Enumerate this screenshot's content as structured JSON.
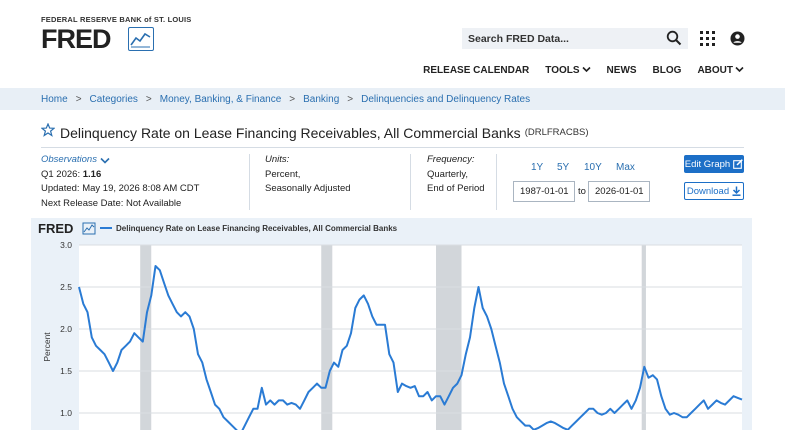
{
  "header": {
    "org": "FEDERAL RESERVE BANK of ST. LOUIS",
    "logo": "FRED",
    "search_placeholder": "Search FRED Data...",
    "icons": [
      "search-icon",
      "apps-grid-icon",
      "account-icon"
    ]
  },
  "nav": {
    "items": [
      {
        "label": "RELEASE CALENDAR"
      },
      {
        "label": "TOOLS"
      },
      {
        "label": "NEWS"
      },
      {
        "label": "BLOG"
      },
      {
        "label": "ABOUT"
      }
    ]
  },
  "breadcrumb": [
    "Home",
    "Categories",
    "Money, Banking, & Finance",
    "Banking",
    "Delinquencies and Delinquency Rates"
  ],
  "series": {
    "title": "Delinquency Rate on Lease Financing Receivables, All Commercial Banks",
    "id": "(DRLFRACBS)"
  },
  "observations": {
    "label": "Observations",
    "latest_period": "Q1 2026:",
    "latest_value": "1.16",
    "updated": "Updated: May 19, 2026 8:08 AM CDT",
    "next_release": "Next Release Date: Not Available"
  },
  "units": {
    "label": "Units:",
    "line1": "Percent,",
    "line2": "Seasonally Adjusted"
  },
  "frequency": {
    "label": "Frequency:",
    "line1": "Quarterly,",
    "line2": "End of Period"
  },
  "range": {
    "buttons": [
      "1Y",
      "5Y",
      "10Y",
      "Max"
    ],
    "start": "1987-01-01",
    "to": "to",
    "end": "2026-01-01"
  },
  "actions": {
    "edit": "Edit Graph",
    "download": "Download"
  },
  "colors": {
    "accent": "#1c6fc7",
    "line": "#2a7bd4",
    "recession": "#d2d6da",
    "panel": "#eaf1f8"
  },
  "chart_data": {
    "type": "line",
    "title": "Delinquency Rate on Lease Financing Receivables, All Commercial Banks",
    "ylabel": "Percent",
    "ylim": [
      0.5,
      3.0
    ],
    "yticks": [
      "3.0",
      "2.5",
      "2.0",
      "1.5",
      "1.0"
    ],
    "x_start": 1987.0,
    "x_end": 2026.0,
    "recessions": [
      [
        1990.6,
        1991.25
      ],
      [
        2001.25,
        2001.9
      ],
      [
        2008.0,
        2009.5
      ],
      [
        2020.1,
        2020.35
      ]
    ],
    "series": [
      {
        "name": "Delinquency Rate on Lease Financing Receivables, All Commercial Banks",
        "points": [
          [
            1987.0,
            2.5
          ],
          [
            1987.25,
            2.3
          ],
          [
            1987.5,
            2.2
          ],
          [
            1987.75,
            1.9
          ],
          [
            1988.0,
            1.8
          ],
          [
            1988.25,
            1.75
          ],
          [
            1988.5,
            1.7
          ],
          [
            1988.75,
            1.6
          ],
          [
            1989.0,
            1.5
          ],
          [
            1989.25,
            1.6
          ],
          [
            1989.5,
            1.75
          ],
          [
            1989.75,
            1.8
          ],
          [
            1990.0,
            1.85
          ],
          [
            1990.25,
            1.95
          ],
          [
            1990.5,
            1.9
          ],
          [
            1990.75,
            1.85
          ],
          [
            1991.0,
            2.2
          ],
          [
            1991.25,
            2.4
          ],
          [
            1991.5,
            2.75
          ],
          [
            1991.75,
            2.7
          ],
          [
            1992.0,
            2.55
          ],
          [
            1992.25,
            2.4
          ],
          [
            1992.5,
            2.3
          ],
          [
            1992.75,
            2.2
          ],
          [
            1993.0,
            2.15
          ],
          [
            1993.25,
            2.2
          ],
          [
            1993.5,
            2.15
          ],
          [
            1993.75,
            2.0
          ],
          [
            1994.0,
            1.7
          ],
          [
            1994.25,
            1.6
          ],
          [
            1994.5,
            1.4
          ],
          [
            1994.75,
            1.25
          ],
          [
            1995.0,
            1.1
          ],
          [
            1995.25,
            1.05
          ],
          [
            1995.5,
            0.95
          ],
          [
            1995.75,
            0.9
          ],
          [
            1996.0,
            0.85
          ],
          [
            1996.25,
            0.8
          ],
          [
            1996.5,
            0.75
          ],
          [
            1996.75,
            0.85
          ],
          [
            1997.0,
            0.95
          ],
          [
            1997.25,
            1.05
          ],
          [
            1997.5,
            1.05
          ],
          [
            1997.75,
            1.3
          ],
          [
            1998.0,
            1.1
          ],
          [
            1998.25,
            1.15
          ],
          [
            1998.5,
            1.1
          ],
          [
            1998.75,
            1.15
          ],
          [
            1999.0,
            1.15
          ],
          [
            1999.25,
            1.1
          ],
          [
            1999.5,
            1.12
          ],
          [
            1999.75,
            1.1
          ],
          [
            2000.0,
            1.05
          ],
          [
            2000.25,
            1.15
          ],
          [
            2000.5,
            1.25
          ],
          [
            2000.75,
            1.3
          ],
          [
            2001.0,
            1.35
          ],
          [
            2001.25,
            1.3
          ],
          [
            2001.5,
            1.3
          ],
          [
            2001.75,
            1.5
          ],
          [
            2002.0,
            1.6
          ],
          [
            2002.25,
            1.55
          ],
          [
            2002.5,
            1.75
          ],
          [
            2002.75,
            1.8
          ],
          [
            2003.0,
            1.95
          ],
          [
            2003.25,
            2.25
          ],
          [
            2003.5,
            2.35
          ],
          [
            2003.75,
            2.4
          ],
          [
            2004.0,
            2.3
          ],
          [
            2004.25,
            2.15
          ],
          [
            2004.5,
            2.05
          ],
          [
            2004.75,
            2.05
          ],
          [
            2005.0,
            2.05
          ],
          [
            2005.25,
            1.7
          ],
          [
            2005.5,
            1.6
          ],
          [
            2005.75,
            1.25
          ],
          [
            2006.0,
            1.35
          ],
          [
            2006.25,
            1.32
          ],
          [
            2006.5,
            1.3
          ],
          [
            2006.75,
            1.32
          ],
          [
            2007.0,
            1.2
          ],
          [
            2007.25,
            1.2
          ],
          [
            2007.5,
            1.25
          ],
          [
            2007.75,
            1.15
          ],
          [
            2008.0,
            1.2
          ],
          [
            2008.25,
            1.2
          ],
          [
            2008.5,
            1.1
          ],
          [
            2008.75,
            1.2
          ],
          [
            2009.0,
            1.3
          ],
          [
            2009.25,
            1.35
          ],
          [
            2009.5,
            1.45
          ],
          [
            2009.75,
            1.7
          ],
          [
            2010.0,
            1.9
          ],
          [
            2010.25,
            2.25
          ],
          [
            2010.5,
            2.5
          ],
          [
            2010.75,
            2.25
          ],
          [
            2011.0,
            2.15
          ],
          [
            2011.25,
            2.0
          ],
          [
            2011.5,
            1.8
          ],
          [
            2011.75,
            1.6
          ],
          [
            2012.0,
            1.35
          ],
          [
            2012.25,
            1.2
          ],
          [
            2012.5,
            1.05
          ],
          [
            2012.75,
            0.95
          ],
          [
            2013.0,
            0.9
          ],
          [
            2013.25,
            0.85
          ],
          [
            2013.5,
            0.85
          ],
          [
            2013.75,
            0.8
          ],
          [
            2014.0,
            0.82
          ],
          [
            2014.25,
            0.85
          ],
          [
            2014.5,
            0.88
          ],
          [
            2014.75,
            0.9
          ],
          [
            2015.0,
            0.88
          ],
          [
            2015.25,
            0.85
          ],
          [
            2015.5,
            0.82
          ],
          [
            2015.75,
            0.8
          ],
          [
            2016.0,
            0.85
          ],
          [
            2016.25,
            0.9
          ],
          [
            2016.5,
            0.95
          ],
          [
            2016.75,
            1.0
          ],
          [
            2017.0,
            1.05
          ],
          [
            2017.25,
            1.05
          ],
          [
            2017.5,
            1.0
          ],
          [
            2017.75,
            0.98
          ],
          [
            2018.0,
            1.0
          ],
          [
            2018.25,
            1.05
          ],
          [
            2018.5,
            1.0
          ],
          [
            2018.75,
            1.05
          ],
          [
            2019.0,
            1.1
          ],
          [
            2019.25,
            1.15
          ],
          [
            2019.5,
            1.05
          ],
          [
            2019.75,
            1.15
          ],
          [
            2020.0,
            1.3
          ],
          [
            2020.25,
            1.55
          ],
          [
            2020.5,
            1.42
          ],
          [
            2020.75,
            1.45
          ],
          [
            2021.0,
            1.4
          ],
          [
            2021.25,
            1.2
          ],
          [
            2021.5,
            1.05
          ],
          [
            2021.75,
            0.98
          ],
          [
            2022.0,
            1.0
          ],
          [
            2022.25,
            0.98
          ],
          [
            2022.5,
            0.95
          ],
          [
            2022.75,
            0.95
          ],
          [
            2023.0,
            1.0
          ],
          [
            2023.25,
            1.05
          ],
          [
            2023.5,
            1.1
          ],
          [
            2023.75,
            1.15
          ],
          [
            2024.0,
            1.05
          ],
          [
            2024.25,
            1.1
          ],
          [
            2024.5,
            1.15
          ],
          [
            2024.75,
            1.12
          ],
          [
            2025.0,
            1.1
          ],
          [
            2025.25,
            1.15
          ],
          [
            2025.5,
            1.2
          ],
          [
            2025.75,
            1.18
          ],
          [
            2026.0,
            1.16
          ]
        ]
      }
    ]
  }
}
